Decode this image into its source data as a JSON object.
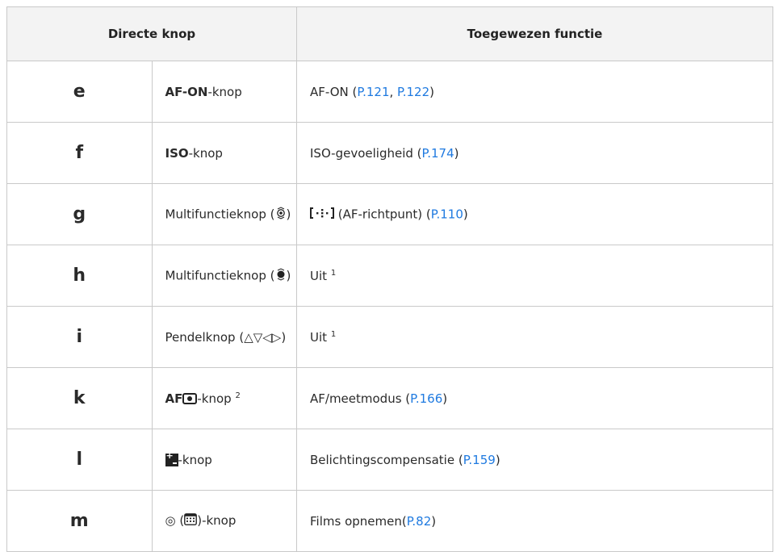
{
  "header": {
    "col1": "Directe knop",
    "col2": "Toegewezen functie"
  },
  "rows": [
    {
      "letter": "e",
      "knop_bold": "AF-ON",
      "knop_rest": "-knop",
      "func": "AF-ON (",
      "link1": "P.121",
      "sep": ", ",
      "link2": "P.122",
      "close": ")"
    },
    {
      "letter": "f",
      "knop_bold": "ISO",
      "knop_rest": "-knop",
      "func": "ISO-gevoeligheid (",
      "link1": "P.174",
      "close": ")"
    },
    {
      "letter": "g",
      "knop_text": "Multifunctieknop (",
      "knop_icon": "multi-selector-icon",
      "knop_close": ")",
      "func_icon": "af-target-icon",
      "func": " (AF-richtpunt) (",
      "link1": "P.110",
      "close": ")"
    },
    {
      "letter": "h",
      "knop_text": "Multifunctieknop (",
      "knop_icon": "multi-selector-press-icon",
      "knop_close": ")",
      "func": "Uit",
      "sup": "1"
    },
    {
      "letter": "i",
      "knop_text": "Pendelknop (",
      "knop_arrows": "△▽◁▷",
      "knop_close": ")",
      "func": "Uit",
      "sup": "1"
    },
    {
      "letter": "k",
      "knop_bold": "AF",
      "knop_icon": "metering-icon",
      "knop_rest": "-knop",
      "knop_sup": "2",
      "func": "AF/meetmodus (",
      "link1": "P.166",
      "close": ")"
    },
    {
      "letter": "l",
      "knop_icon": "exposure-compensation-icon",
      "knop_rest": "-knop",
      "func": "Belichtingscompensatie (",
      "link1": "P.159",
      "close": ")"
    },
    {
      "letter": "m",
      "knop_symbol": "◎",
      "knop_text": " (",
      "knop_icon": "movie-icon",
      "knop_rest": ")-knop",
      "func": "Films opnemen(",
      "link1": "P.82",
      "close": ")"
    }
  ]
}
